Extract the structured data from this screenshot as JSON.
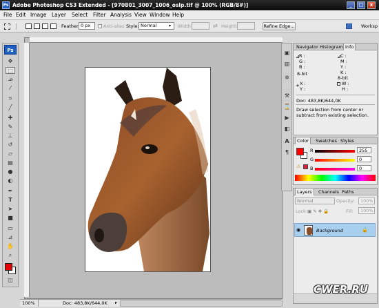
{
  "window": {
    "title": "Adobe Photoshop CS3 Extended - [970801_3007_1006_oslp.tif @ 100% (RGB/8#)]",
    "app_icon": "Ps",
    "controls": [
      "_",
      "□",
      "x"
    ]
  },
  "menu": [
    "File",
    "Edit",
    "Image",
    "Layer",
    "Select",
    "Filter",
    "Analysis",
    "View",
    "Window",
    "Help"
  ],
  "options": {
    "feather_label": "Feather:",
    "feather_value": "0 px",
    "antialias_label": "Anti-alias",
    "style_label": "Style:",
    "style_value": "Normal",
    "width_label": "Width:",
    "height_label": "Height:",
    "refine_label": "Refine Edge...",
    "workspace_label": "Worksp"
  },
  "toolbox": {
    "logo": "Ps",
    "tools": [
      "move-icon",
      "marquee-icon",
      "lasso-icon",
      "magic-wand-icon",
      "crop-icon",
      "slice-icon",
      "healing-icon",
      "brush-icon",
      "stamp-icon",
      "history-brush-icon",
      "eraser-icon",
      "gradient-icon",
      "blur-icon",
      "dodge-icon",
      "pen-icon",
      "type-icon",
      "path-select-icon",
      "shape-icon",
      "notes-icon",
      "eyedropper-icon",
      "hand-icon",
      "zoom-icon"
    ],
    "fg_color": "#e40000",
    "bg_color": "#ffffff"
  },
  "status": {
    "zoom": "100%",
    "doc": "Doc: 483,8K/644,0K"
  },
  "info_panel": {
    "tabs": [
      "Navigator",
      "Histogram",
      "Info"
    ],
    "active_tab": "Info",
    "left_channels": [
      "R :",
      "G :",
      "B :"
    ],
    "right_channels": [
      "C :",
      "M :",
      "Y :",
      "K :"
    ],
    "bit_left": "8-bit",
    "bit_right": "8-bit",
    "x": "X :",
    "y": "Y :",
    "w": "W :",
    "h": "H :",
    "doc": "Doc: 483,8K/644,0K",
    "hint": "Draw selection from center or subtract from existing selection."
  },
  "color_panel": {
    "tabs": [
      "Color",
      "Swatches",
      "Styles"
    ],
    "active_tab": "Color",
    "channels": [
      {
        "label": "R",
        "value": "255",
        "level": 1.0
      },
      {
        "label": "G",
        "value": "0",
        "level": 0
      },
      {
        "label": "B",
        "value": "0",
        "level": 0
      }
    ],
    "swatch": "#ff0000"
  },
  "layers_panel": {
    "tabs": [
      "Layers",
      "Channels",
      "Paths"
    ],
    "active_tab": "Layers",
    "blend_mode": "Normal",
    "opacity_label": "Opacity:",
    "opacity_value": "100%",
    "lock_label": "Lock:",
    "fill_label": "Fill:",
    "fill_value": "100%",
    "layers": [
      {
        "name": "Background",
        "visible": true,
        "locked": true
      }
    ]
  },
  "watermark": "CWER.RU"
}
